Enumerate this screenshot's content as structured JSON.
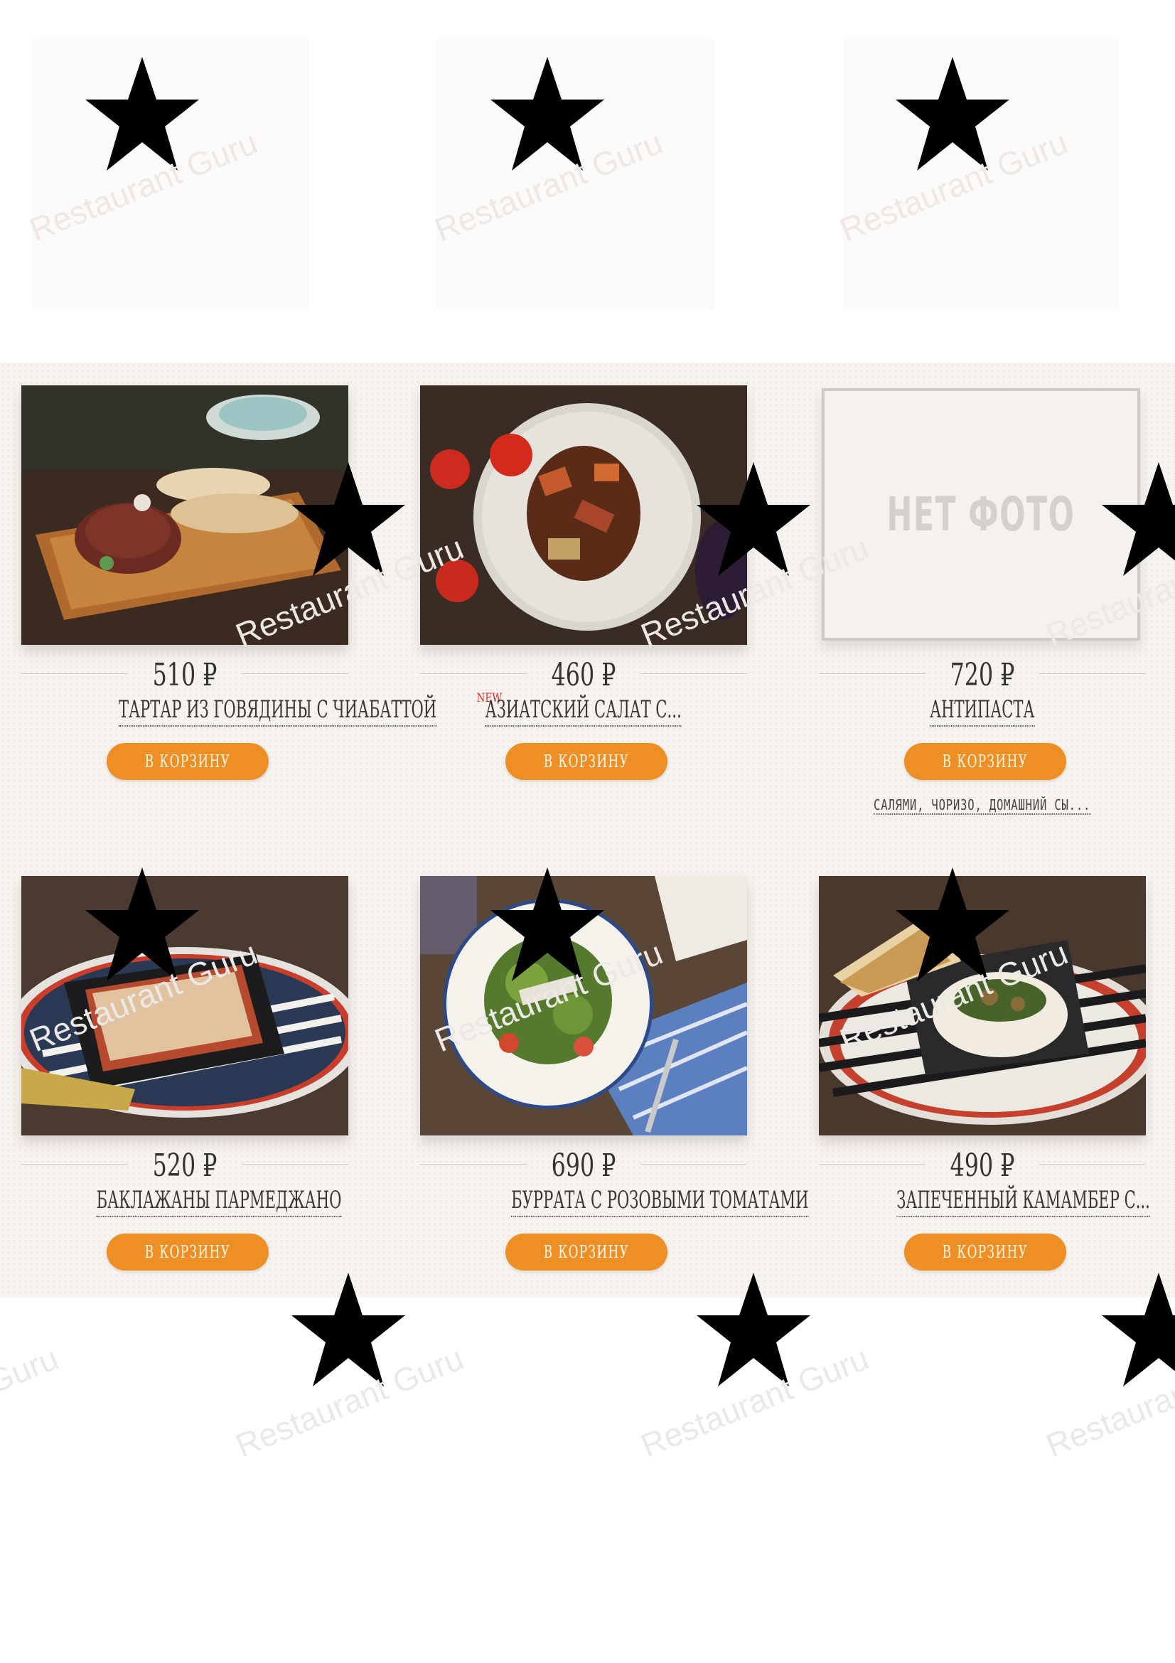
{
  "watermark": {
    "text": "Restaurant Guru",
    "icon": "star-fork-icon"
  },
  "no_photo_text": "НЕТ ФОТО",
  "cart_button_label": "В КОРЗИНУ",
  "products": [
    {
      "price": "510 ₽",
      "name": "ТАРТАР ИЗ ГОВЯДИНЫ С ЧИАБАТТОЙ",
      "image": "beef-tartare-photo"
    },
    {
      "price": "460 ₽",
      "name": "АЗИАТСКИЙ САЛАТ С...",
      "badge": "NEW",
      "image": "asian-salad-photo"
    },
    {
      "price": "720 ₽",
      "name": "АНТИПАСТА",
      "description": "САЛЯМИ, ЧОРИЗО, ДОМАШНИЙ СЫ...",
      "image": "no-photo"
    },
    {
      "price": "520 ₽",
      "name": "БАКЛАЖАНЫ ПАРМЕДЖАНО",
      "image": "eggplant-parmigiana-photo"
    },
    {
      "price": "690 ₽",
      "name": "БУРРАТА С РОЗОВЫМИ ТОМАТАМИ",
      "image": "burrata-salad-photo"
    },
    {
      "price": "490 ₽",
      "name": "ЗАПЕЧЕННЫЙ КАМАМБЕР С...",
      "image": "baked-camembert-photo"
    }
  ],
  "colors": {
    "button": "#ee8f25",
    "band_background": "#f6f2ee",
    "new_badge": "#d4302b"
  }
}
